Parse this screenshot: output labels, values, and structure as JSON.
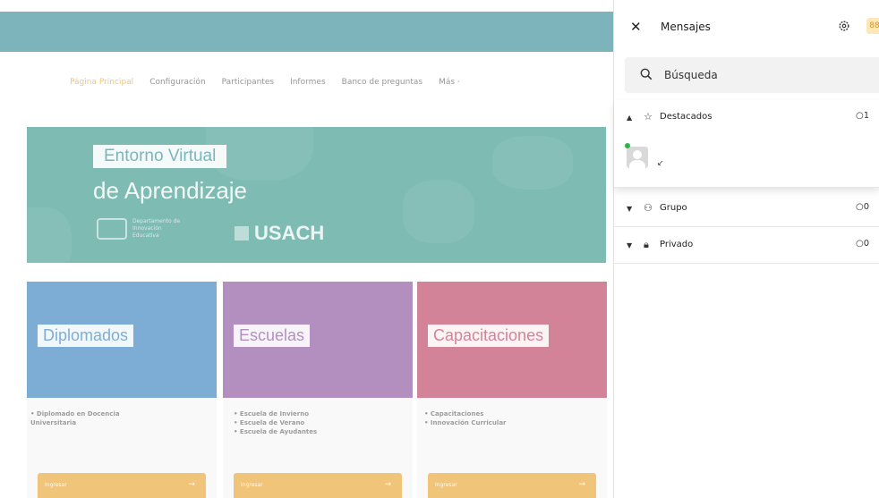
{
  "page": {
    "nav": [
      "Página Principal",
      "Configuración",
      "Participantes",
      "Informes",
      "Banco de preguntas",
      "Más ·"
    ],
    "hero": {
      "line1": "Entorno Virtual",
      "line2": "de Aprendizaje",
      "logo1_text": "Departamento de Innovación Educativa",
      "logo2_text": "USACH"
    },
    "cards": [
      {
        "title": "Diplomados",
        "color": "#1f73b7",
        "links": [
          "• Diplomado en Docencia",
          "  Universitaria"
        ],
        "button": "Ingresar"
      },
      {
        "title": "Escuelas",
        "color": "#7b3f8f",
        "links": [
          "• Escuela de Invierno",
          "• Escuela de Verano",
          "• Escuela de Ayudantes"
        ],
        "button": "Ingresar"
      },
      {
        "title": "Capacitaciones",
        "color": "#b32a4c",
        "links": [
          "• Capacitaciones",
          "• Innovación Curricular"
        ],
        "button": "Ingresar"
      }
    ]
  },
  "drawer": {
    "title": "Mensajes",
    "search_placeholder": "Búsqueda",
    "sections": {
      "starred": {
        "label": "Destacados",
        "count": "1"
      },
      "group": {
        "label": "Grupo",
        "count": "0"
      },
      "private": {
        "label": "Privado",
        "count": "0"
      }
    }
  },
  "colors": {
    "teal": "#1f7f8a",
    "accent": "#e69a19",
    "online": "#2db34a"
  }
}
